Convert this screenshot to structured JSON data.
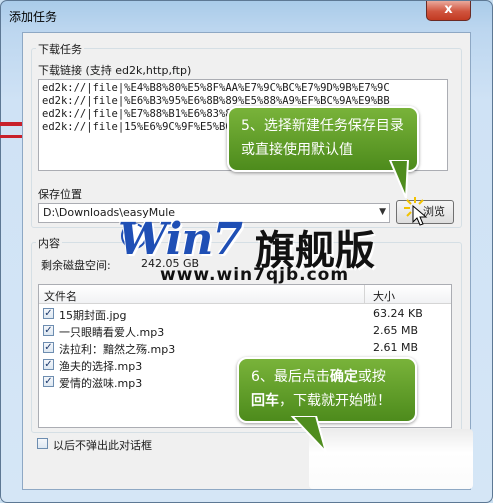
{
  "window": {
    "title": "添加任务",
    "close_glyph": "x"
  },
  "download_task": {
    "group_label": "下载任务",
    "links_label": "下载链接 (支持 ed2k,http,ftp)",
    "links": [
      "ed2k://|file|%E4%B8%80%E5%8F%AA%E7%9C%BC%E7%9D%9B%E7%9C",
      "ed2k://|file|%E6%B3%95%E6%8B%89%E5%88%A9%EF%BC%9A%E9%BB",
      "ed2k://|file|%E7%88%B1%E6%83%85%E7%9A%84%E6%BB%8B%E5%91",
      "ed2k://|file|15%E6%9C%9F%E5%B0%81%E9%9D%A2.jpg|63239|E"
    ]
  },
  "save_location": {
    "label": "保存位置",
    "path": "D:\\Downloads\\easyMule",
    "browse_label": "浏览"
  },
  "content": {
    "group_label": "内容",
    "free_space_label": "剩余磁盘空间:",
    "free_space_value": "242.05 GB",
    "columns": [
      "文件名",
      "大小"
    ],
    "files": [
      {
        "name": "15期封面.jpg",
        "size": "63.24 KB",
        "checked": true
      },
      {
        "name": "一只眼睛看爱人.mp3",
        "size": "2.65 MB",
        "checked": true
      },
      {
        "name": "法拉利：黯然之殇.mp3",
        "size": "2.61 MB",
        "checked": true
      },
      {
        "name": "渔夫的选择.mp3",
        "size": "",
        "checked": true
      },
      {
        "name": "爱情的滋味.mp3",
        "size": "",
        "checked": true
      }
    ]
  },
  "dont_show_again_label": "以后不弹出此对话框",
  "watermark": {
    "brand": "Win7",
    "brand_cn": "旗舰版",
    "url": "www.win7qjb.com"
  },
  "callouts": {
    "step5": "5、选择新建任务保存目录或直接使用默认值",
    "step6_prefix": "6、最后点击",
    "step6_bold1": "确定",
    "step6_mid": "或按",
    "step6_bold2": "回车",
    "step6_suffix": "，下载就开始啦！"
  },
  "colors": {
    "callout_green": "#5f9e28",
    "watermark_blue": "#1f4fb5",
    "close_red": "#c94a33"
  }
}
